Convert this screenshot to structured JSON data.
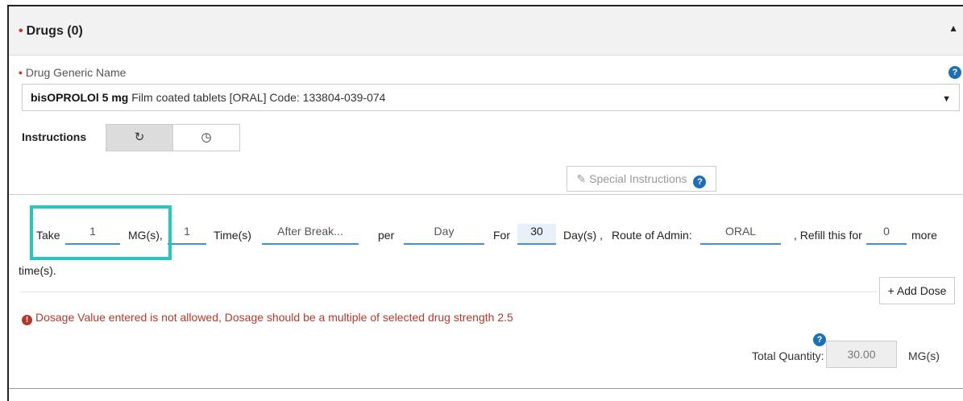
{
  "section": {
    "title": "Drugs (0)",
    "required_marker": "•",
    "collapse_icon": "caret-up-icon"
  },
  "drug_field": {
    "required_marker": "•",
    "label": "Drug Generic Name",
    "help_glyph": "?",
    "value_bold": "bisOPROLOl 5 mg",
    "value_rest": " Film coated tablets [ORAL] Code: 133804-039-074",
    "caret": "▼"
  },
  "instructions": {
    "label": "Instructions",
    "toggle_repeat_glyph": "↻",
    "toggle_clock_glyph": "◷"
  },
  "special_instructions": {
    "pencil_glyph": "✎",
    "label": "Special Instructions",
    "help_glyph": "?"
  },
  "dosage": {
    "take_label": "Take",
    "dose_value": "1",
    "dose_unit": "MG(s),",
    "frequency_value": "1",
    "frequency_unit": "Time(s)",
    "timing_value": "After Break...",
    "per_label": "per",
    "period_value": "Day",
    "for_label": "For",
    "duration_value": "30",
    "duration_unit": "Day(s) ,",
    "route_label": "Route of Admin:",
    "route_value": "ORAL",
    "refill_label": ", Refill this for",
    "refill_value": "0",
    "more_label": "more",
    "times_label": "time(s)."
  },
  "add_dose": {
    "label": "+ Add Dose"
  },
  "error": {
    "icon_glyph": "!",
    "message": "Dosage Value entered is not allowed, Dosage should be a multiple of selected drug strength 2.5"
  },
  "total_quantity": {
    "help_glyph": "?",
    "label": "Total Quantity:",
    "value": "30.00",
    "unit": "MG(s)"
  },
  "colors": {
    "accent_blue": "#1f6fb5",
    "error_red": "#b03a2e",
    "highlight_teal": "#27c7c0",
    "underline_blue": "#4a90c8"
  }
}
